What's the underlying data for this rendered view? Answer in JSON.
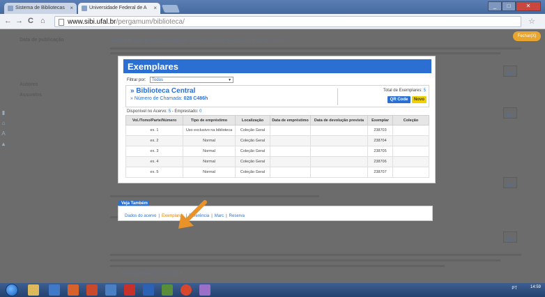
{
  "browser": {
    "tabs": [
      {
        "label": "Sistema de Bibliotecas",
        "active": false
      },
      {
        "label": "Universidade Federal de A",
        "active": true
      }
    ],
    "url_host": "www.sibi.ufal.br",
    "url_path": "/pergamum/biblioteca/",
    "close_tab": "×"
  },
  "page": {
    "sidebar_heading_1": "Data de publicação",
    "sidebar_heading_2": "Autores",
    "sidebar_heading_3": "Assuntos",
    "close_button": "Fechar(X)",
    "result_title": "Aventura do livro : do leitor ao navegador : conversações com Jean Lebrun , 6 / 2008 / ( Livros )",
    "result_footer": "Nº de Chamada: 37.1C S3 T31 E"
  },
  "modal": {
    "title": "Exemplares",
    "filter_label": "Filtrar por:",
    "filter_value": "Todos",
    "library_name": "» Biblioteca Central",
    "call_number_label": "» Número de Chamada:",
    "call_number": "028 C486h",
    "total_label": "Total de Exemplares:",
    "total_value": "5",
    "qr_button": "QR Code",
    "novo_button": "Novo",
    "available_label": "Disponível no Acervo:",
    "available_value": "5",
    "loaned_label": "- Emprestado:",
    "loaned_value": "0",
    "columns": [
      "Vol./Tomo/Parte/Número",
      "Tipo de empréstimo",
      "Localização",
      "Data de empréstimo",
      "Data de devolução prevista",
      "Exemplar",
      "Coleção"
    ],
    "rows": [
      [
        "ex. 1",
        "Uso exclusivo na biblioteca",
        "Coleção Geral",
        "",
        "",
        "238703",
        ""
      ],
      [
        "ex. 2",
        "Normal",
        "Coleção Geral",
        "",
        "",
        "238704",
        ""
      ],
      [
        "ex. 3",
        "Normal",
        "Coleção Geral",
        "",
        "",
        "238705",
        ""
      ],
      [
        "ex. 4",
        "Normal",
        "Coleção Geral",
        "",
        "",
        "238706",
        ""
      ],
      [
        "ex. 5",
        "Normal",
        "Coleção Geral",
        "",
        "",
        "238707",
        ""
      ]
    ]
  },
  "see_also": {
    "title": "Veja Também",
    "links": [
      "Dados do acervo",
      "Exemplares",
      "Referência",
      "Marc",
      "Reserva"
    ],
    "active_index": 1
  },
  "taskbar": {
    "tray_text": "PT",
    "time": "14:59"
  },
  "colors": {
    "accent": "#2a6fd1",
    "active_link": "#e27e00",
    "novo_button": "#f2d100"
  }
}
